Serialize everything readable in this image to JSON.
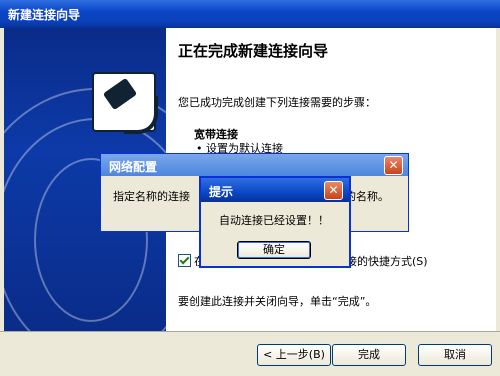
{
  "window": {
    "title": "新建连接向导"
  },
  "wizard": {
    "heading": "正在完成新建连接向导",
    "intro": "您已成功完成创建下列连接需要的步骤：",
    "section_title": "宽带连接",
    "bullet1": "• 设置为默认连接",
    "shortcut_prefix": "在",
    "shortcut_suffix": "接的快捷方式(S)",
    "shortcut_checked": true,
    "finish_hint": "要创建此连接并关闭向导，单击“完成”。"
  },
  "buttons": {
    "back": "< 上一步(B)",
    "finish": "完成",
    "cancel": "取消"
  },
  "dialog_config": {
    "title": "网络配置",
    "close": "✕",
    "msg_left": "指定名称的连接",
    "msg_right": "的名称。"
  },
  "dialog_prompt": {
    "title": "提示",
    "close": "✕",
    "message": "自动连接已经设置！！",
    "ok": "确定"
  }
}
